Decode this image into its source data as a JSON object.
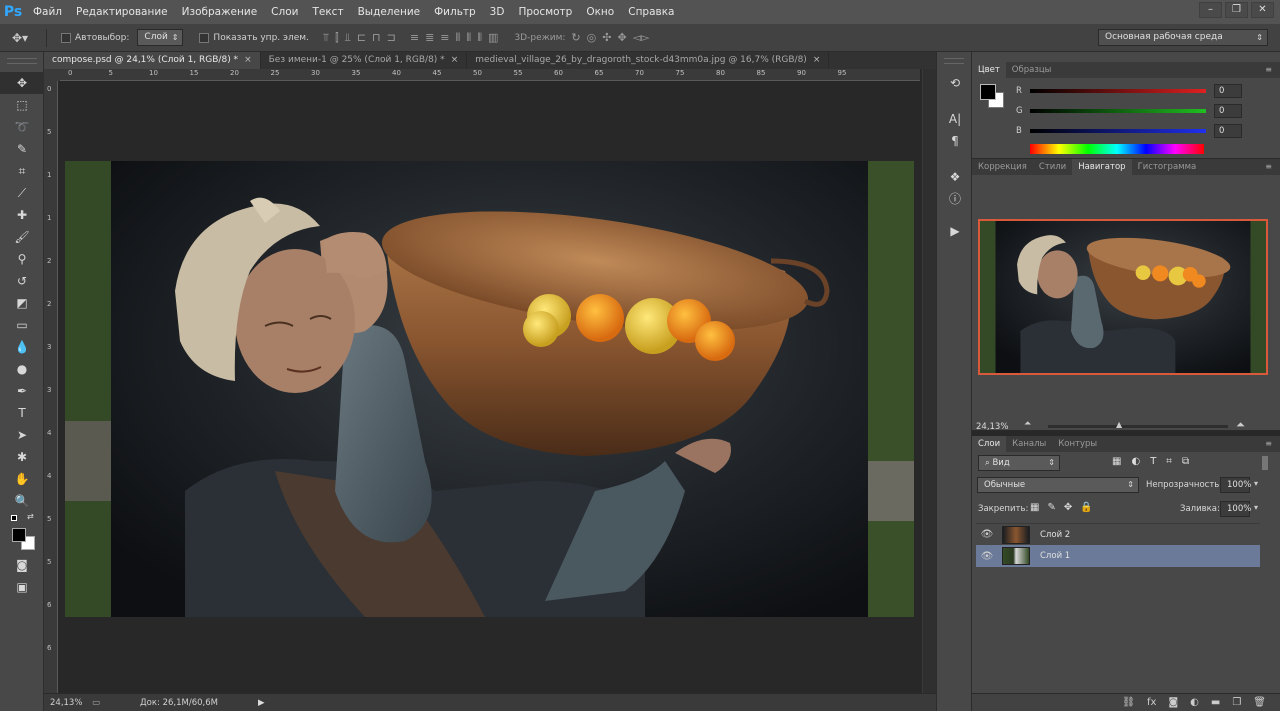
{
  "app": {
    "logo": "Ps"
  },
  "menu": [
    "Файл",
    "Редактирование",
    "Изображение",
    "Слои",
    "Текст",
    "Выделение",
    "Фильтр",
    "3D",
    "Просмотр",
    "Окно",
    "Справка"
  ],
  "options": {
    "autoselect_label": "Автовыбор:",
    "autoselect_value": "Слой",
    "show_transform_label": "Показать упр. элем.",
    "mode3d_label": "3D-режим:",
    "workspace": "Основная рабочая среда"
  },
  "tabs": [
    {
      "label": "compose.psd @ 24,1% (Слой 1, RGB/8) *",
      "active": true
    },
    {
      "label": "Без имени-1 @ 25% (Слой 1, RGB/8) *",
      "active": false
    },
    {
      "label": "medieval_village_26_by_dragoroth_stock-d43mm0a.jpg @ 16,7% (RGB/8)",
      "active": false
    }
  ],
  "ruler": {
    "h_ticks": [
      "0",
      "5",
      "10",
      "15",
      "20",
      "25",
      "30",
      "35",
      "40",
      "45",
      "50",
      "55",
      "60",
      "65",
      "70",
      "75",
      "80",
      "85",
      "90",
      "95"
    ],
    "v_ticks": [
      "0",
      "5",
      "1",
      "1",
      "2",
      "2",
      "3",
      "3",
      "4",
      "4",
      "5",
      "5",
      "6",
      "6"
    ]
  },
  "status": {
    "zoom": "24,13%",
    "doc": "Док: 26,1M/60,6M"
  },
  "color_panel": {
    "tabs": [
      "Цвет",
      "Образцы"
    ],
    "channels": [
      {
        "label": "R",
        "value": "0",
        "color": "#d83030"
      },
      {
        "label": "G",
        "value": "0",
        "color": "#30b030"
      },
      {
        "label": "B",
        "value": "0",
        "color": "#3040e0"
      }
    ]
  },
  "nav_panel": {
    "tabs": [
      "Коррекция",
      "Стили",
      "Навигатор",
      "Гистограмма"
    ],
    "zoom": "24,13%"
  },
  "layers_panel": {
    "tabs": [
      "Слои",
      "Каналы",
      "Контуры"
    ],
    "filter": "Вид",
    "blend_mode": "Обычные",
    "opacity_label": "Непрозрачность:",
    "opacity_value": "100%",
    "lock_label": "Закрепить:",
    "fill_label": "Заливка:",
    "fill_value": "100%",
    "layers": [
      {
        "name": "Слой 2",
        "selected": false
      },
      {
        "name": "Слой 1",
        "selected": true
      }
    ]
  }
}
